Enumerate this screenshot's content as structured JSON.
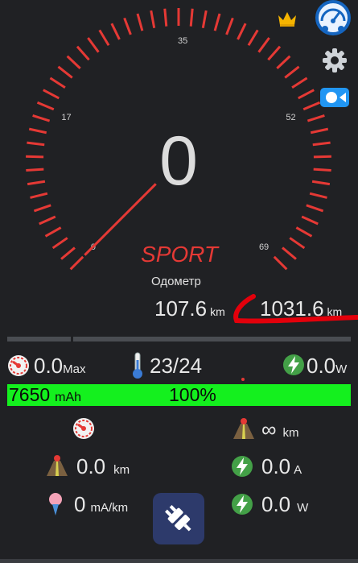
{
  "speedometer": {
    "speed": "0",
    "mode": "SPORT",
    "scale_labels": [
      "0",
      "17",
      "35",
      "52",
      "69"
    ],
    "scale_min": 0,
    "scale_max": 69,
    "needle_value": 0
  },
  "odometer": {
    "label": "Одометр",
    "trip_value": "107.6",
    "trip_unit": "km",
    "total_value": "1031.6",
    "total_unit": "km"
  },
  "stats": {
    "max_speed_value": "0.0",
    "max_speed_unit": "Max",
    "temperature": "23/24",
    "power": "0.0",
    "power_unit": "W"
  },
  "battery": {
    "capacity": "7650",
    "capacity_unit": "mAh",
    "percent": "100%",
    "level": 1.0
  },
  "details": {
    "range_value": "∞",
    "range_unit": "km",
    "distance_value": "0.0",
    "distance_unit": "km",
    "current_value": "0.0",
    "current_unit": "A",
    "consumption_value": "0",
    "consumption_unit": "mA/km",
    "power_value": "0.0",
    "power_unit": "W"
  },
  "colors": {
    "accent_red": "#e53935",
    "battery_green": "#14f01e",
    "fab": "#2d3a6b",
    "background": "#202124"
  },
  "icons": [
    "crown-icon",
    "speedometer-app-icon",
    "gear-icon",
    "video-camera-icon",
    "speed-gauge-icon",
    "thermometer-icon",
    "lightning-icon",
    "road-icon",
    "balloon-icon",
    "plug-icon"
  ]
}
